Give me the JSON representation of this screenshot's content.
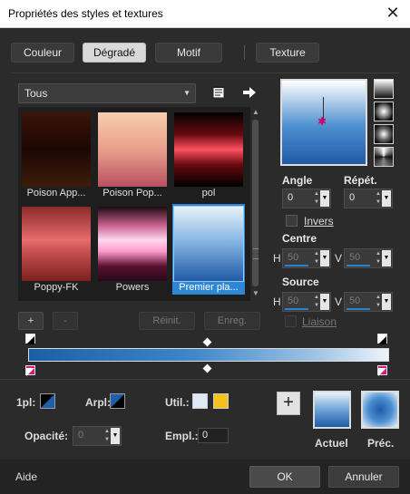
{
  "window": {
    "title": "Propriétés des styles et textures",
    "close_glyph": "✕"
  },
  "tabs": [
    {
      "label": "Couleur",
      "active": false
    },
    {
      "label": "Dégradé",
      "active": true
    },
    {
      "label": "Motif",
      "active": false
    },
    {
      "label": "Texture",
      "active": false
    }
  ],
  "category": {
    "selected": "Tous"
  },
  "swatches": [
    {
      "label": "Poison App...",
      "gradient": [
        "#3a1408",
        "#2a0b04",
        "#3d1d08"
      ]
    },
    {
      "label": "Poison Pop...",
      "gradient": [
        "#f5c4a8",
        "#e8a08c",
        "#b85060"
      ]
    },
    {
      "label": "pol",
      "gradient": [
        "#000000",
        "#ff5060",
        "#000000"
      ]
    },
    {
      "label": "Poppy-FK",
      "gradient": [
        "#8a2a2a",
        "#e86c6c",
        "#7a2020"
      ]
    },
    {
      "label": "Powers",
      "gradient": [
        "#1a0a10",
        "#ffd8ee",
        "#2a0818"
      ]
    },
    {
      "label": "Premier pla...",
      "gradient": [
        "#e8f2fb",
        "#7fb0e0",
        "#1f5aa6"
      ],
      "selected": true
    }
  ],
  "list_buttons": {
    "add": "+",
    "remove": "-",
    "reset": "Réinit.",
    "save": "Enreg."
  },
  "angle": {
    "label": "Angle",
    "value": "0"
  },
  "repeats": {
    "label": "Répét.",
    "value": "0"
  },
  "invert": {
    "label": "Invers",
    "checked": false
  },
  "center": {
    "label": "Centre",
    "h_label": "H",
    "h_value": "50",
    "v_label": "V",
    "v_value": "50"
  },
  "source": {
    "label": "Source",
    "h_label": "H",
    "h_value": "50",
    "v_label": "V",
    "v_value": "50"
  },
  "link": {
    "label": "Liaison",
    "checked": false
  },
  "stop_controls": {
    "first_plane_label": "1pl:",
    "background_plane_label": "Arpl:",
    "use_label": "Util.:",
    "use_colors": [
      "#dfe8f4",
      "#f4c21c"
    ],
    "opacity_label": "Opacité:",
    "opacity_value": "0",
    "position_label": "Empl.:",
    "position_value": "0"
  },
  "previews": {
    "current_label": "Actuel",
    "previous_label": "Préc."
  },
  "footer": {
    "help_label": "Aide",
    "ok_label": "OK",
    "cancel_label": "Annuler"
  },
  "icons": [
    "close-icon",
    "book-icon",
    "arrow-right-icon",
    "chevron-down-icon",
    "up-arrow-icon",
    "down-arrow-icon",
    "plus-icon"
  ]
}
